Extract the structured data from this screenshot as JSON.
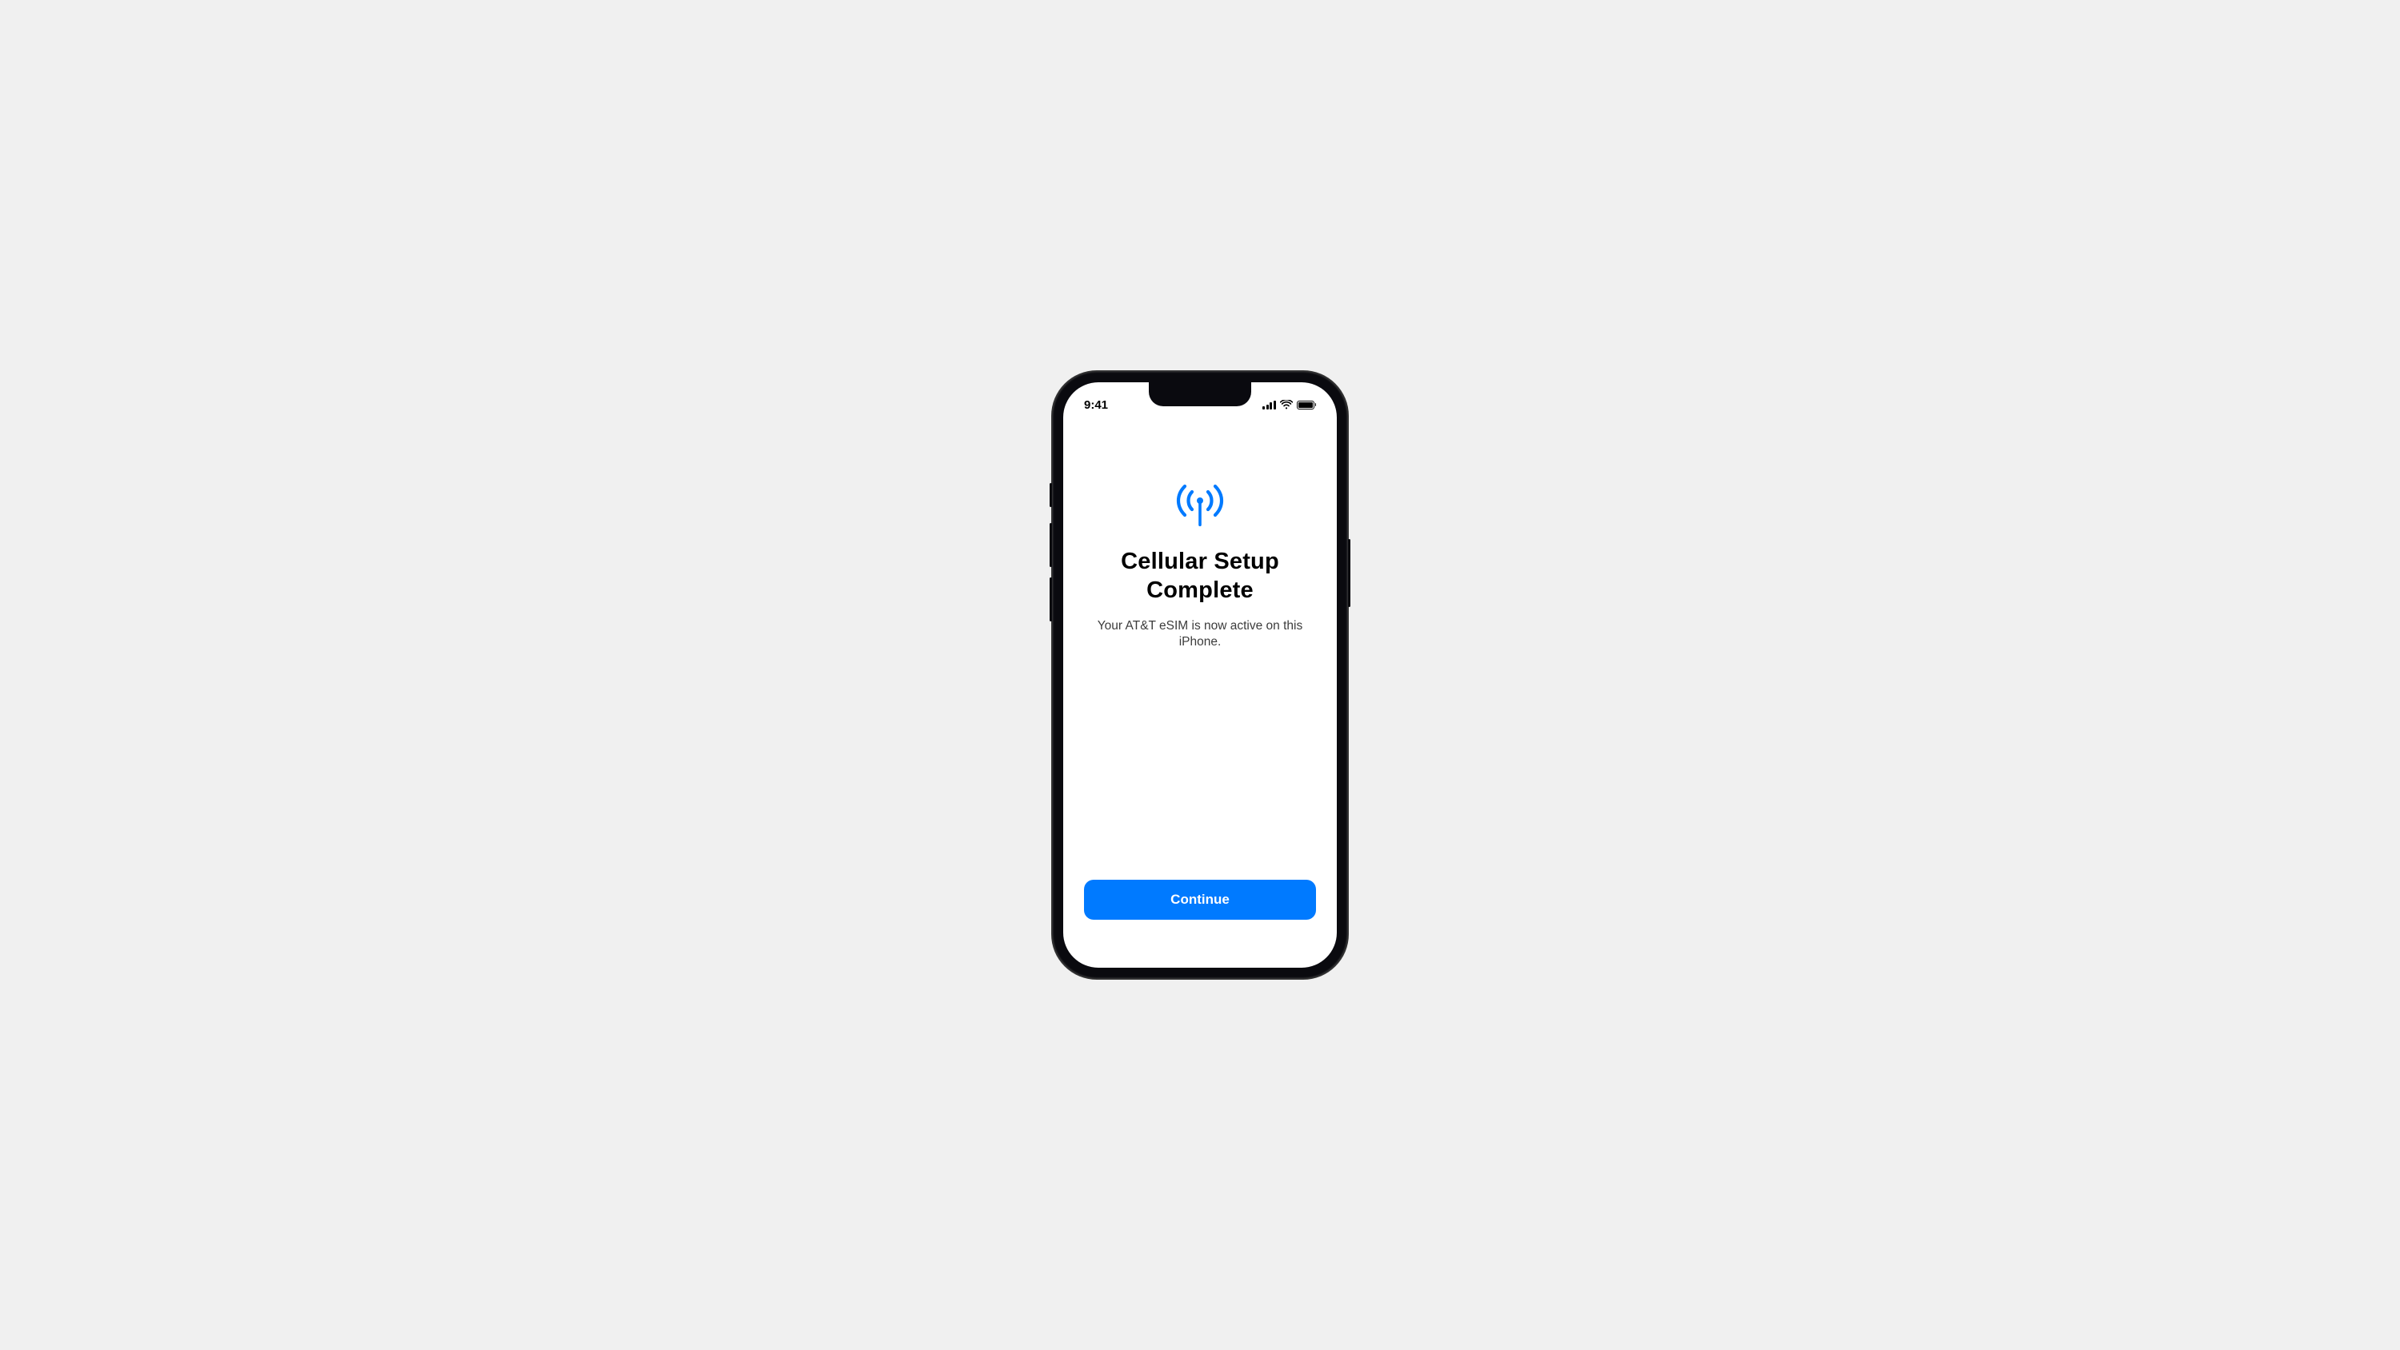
{
  "status_bar": {
    "time": "9:41"
  },
  "screen": {
    "icon_name": "cellular-antenna-icon",
    "title": "Cellular Setup Complete",
    "subtitle": "Your AT&T eSIM is now active on this iPhone.",
    "button_label": "Continue"
  },
  "colors": {
    "accent": "#007aff",
    "background": "#f0f0f0"
  }
}
